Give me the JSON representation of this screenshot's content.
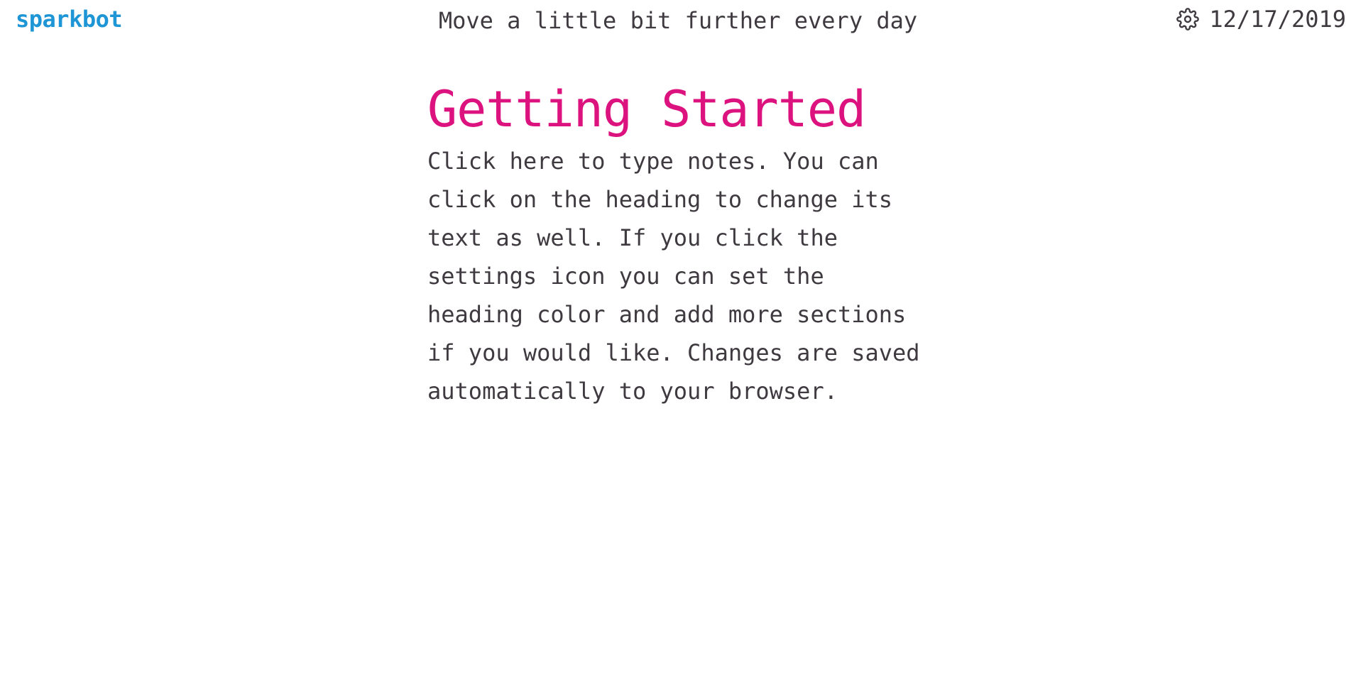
{
  "header": {
    "brand": "sparkbot",
    "motto": "Move a little bit further every day",
    "settings_icon": "gear-icon",
    "date": "12/17/2019"
  },
  "section": {
    "heading": "Getting Started",
    "notes": "Click here to type notes. You can click on the heading to change its text as well. If you click the settings icon you can set the heading color and add more sections if you would like. Changes are saved automatically to your browser."
  },
  "colors": {
    "brand": "#1e96d6",
    "heading": "#dc127f",
    "text": "#3f3a40",
    "background": "#ffffff"
  }
}
